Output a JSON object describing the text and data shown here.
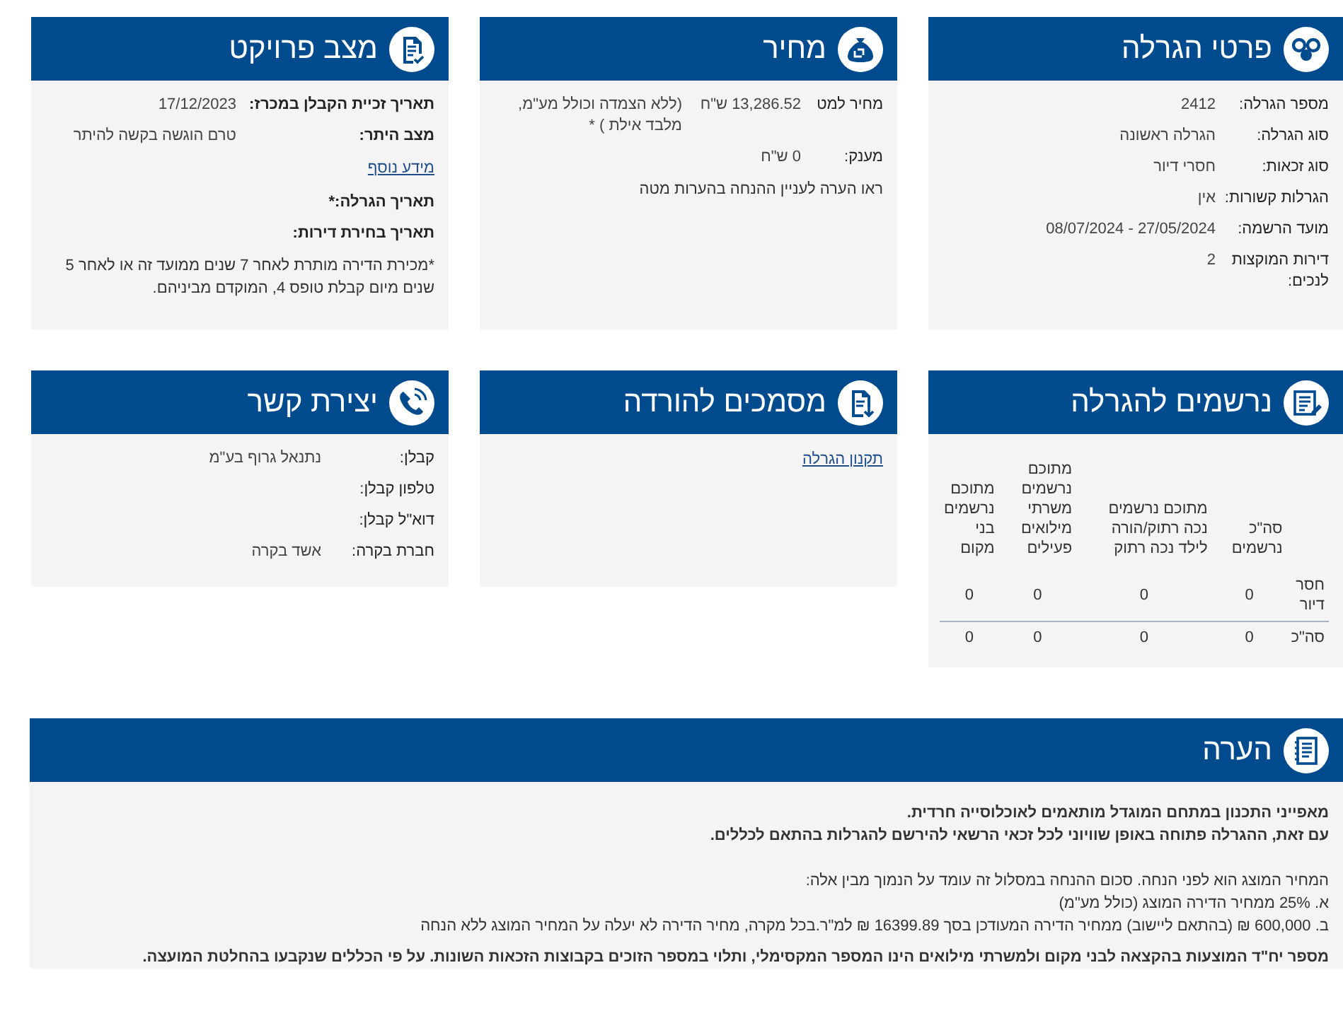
{
  "cards": [
    {
      "kind": "details",
      "title": "פרטי הגרלה",
      "rows": [
        {
          "kind": "field",
          "label": "מספר הגרלה:",
          "value": "2412"
        },
        {
          "kind": "field",
          "label": "סוג הגרלה:",
          "value": "הגרלה ראשונה"
        },
        {
          "kind": "field",
          "label": "סוג זכאות:",
          "value": "חסרי דיור"
        },
        {
          "kind": "field",
          "label": "הגרלות קשורות:",
          "value": "אין"
        },
        {
          "kind": "field",
          "label": "מועד הרשמה:",
          "value": "27/05/2024 - 08/07/2024"
        },
        {
          "kind": "field",
          "label": "דירות המוקצות לנכים:",
          "value": "2"
        }
      ]
    },
    {
      "kind": "price",
      "title": "מחיר",
      "rows": [
        {
          "kind": "field",
          "label": "מחיר למט",
          "value": "13,286.52 ש\"ח",
          "note": "(ללא הצמדה וכולל מע\"מ, מלבד אילת ) *"
        },
        {
          "kind": "field",
          "label": "מענק:",
          "value": "0 ש\"ח"
        },
        {
          "kind": "text",
          "text": "ראו הערה לעניין ההנחה בהערות מטה"
        }
      ]
    },
    {
      "kind": "status",
      "title": "מצב פרויקט",
      "rows": [
        {
          "kind": "field",
          "label": "תאריך זכיית הקבלן במכרז:",
          "value": "17/12/2023"
        },
        {
          "kind": "field",
          "label": "מצב היתר:",
          "value": "טרם הוגשה בקשה להיתר"
        },
        {
          "kind": "link",
          "text": "מידע נוסף"
        },
        {
          "kind": "field",
          "label": "תאריך הגרלה:*"
        },
        {
          "kind": "field",
          "label": "תאריך בחירת דירות:"
        },
        {
          "kind": "text",
          "text": "*מכירת הדירה מותרת לאחר 7 שנים ממועד זה או לאחר 5 שנים מיום קבלת טופס 4, המוקדם מביניהם."
        }
      ]
    },
    {
      "kind": "registrants",
      "title": "נרשמים להגרלה",
      "table": {
        "columns": [
          "סה\"כ נרשמים",
          "מתוכם נרשמים נכה רתוק/הורה לילד נכה רתוק",
          "מתוכם נרשמים משרתי מילואים פעילים",
          "מתוכם נרשמים בני מקום"
        ],
        "rows": [
          {
            "label": "חסר דיור",
            "cells": [
              "0",
              "0",
              "0",
              "0"
            ]
          },
          {
            "label": "סה\"כ",
            "cells": [
              "0",
              "0",
              "0",
              "0"
            ]
          }
        ]
      }
    },
    {
      "kind": "documents",
      "title": "מסמכים להורדה",
      "rows": [
        {
          "kind": "link",
          "text": "תקנון הגרלה"
        }
      ]
    },
    {
      "kind": "contact",
      "title": "יצירת קשר",
      "rows": [
        {
          "kind": "field",
          "label": "קבלן:",
          "value": "נתנאל גרוף בע\"מ"
        },
        {
          "kind": "field",
          "label": "טלפון קבלן:"
        },
        {
          "kind": "field",
          "label": "דוא\"ל קבלן:"
        },
        {
          "kind": "field",
          "label": "חברת בקרה:",
          "value": "אשד בקרה"
        }
      ]
    }
  ],
  "note": {
    "title": "הערה",
    "paragraphs": [
      {
        "bold": true,
        "lines": [
          "מאפייני התכנון במתחם המוגדל מותאמים לאוכלוסייה חרדית.",
          "עם זאת, ההגרלה פתוחה באופן שוויוני לכל זכאי הרשאי להירשם להגרלות בהתאם לכללים."
        ]
      },
      {
        "bold": false,
        "lines": [
          "המחיר המוצג הוא לפני הנחה. סכום ההנחה במסלול זה עומד על הנמוך מבין אלה:",
          "א. 25% ממחיר הדירה המוצג (כולל מע\"מ)",
          "ב. 600,000 ₪ (בהתאם ליישוב) ממחיר הדירה המעודכן בסך 16399.89 ₪ למ\"ר.בכל מקרה, מחיר הדירה לא יעלה על המחיר המוצג ללא הנחה"
        ]
      },
      {
        "bold": true,
        "lines": [
          "מספר יח\"ד המוצעות בהקצאה לבני מקום ולמשרתי מילואים הינו המספר המקסימלי, ותלוי במספר הזוכים בקבוצות הזכאות השונות. על פי הכללים שנקבעו בהחלטת המועצה."
        ]
      }
    ]
  }
}
